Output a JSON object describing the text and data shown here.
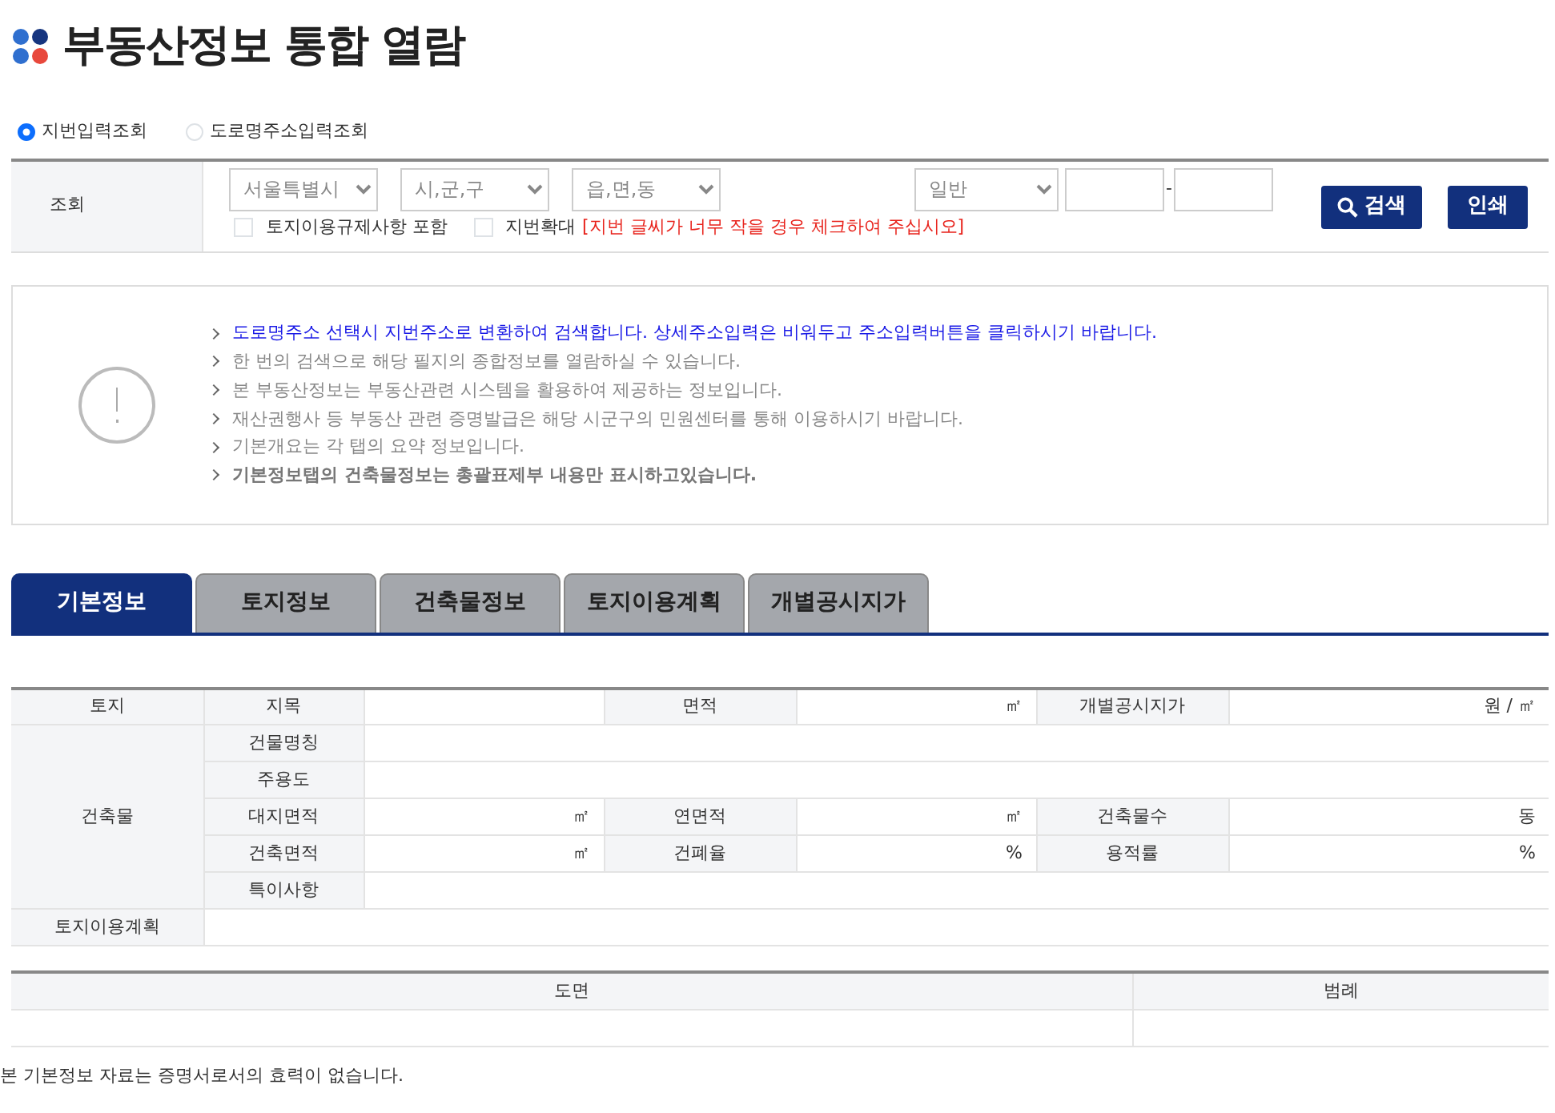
{
  "page": {
    "title": "부동산정보 통합 열람"
  },
  "search_mode": [
    {
      "label": "지번입력조회",
      "selected": true
    },
    {
      "label": "도로명주소입력조회",
      "selected": false
    }
  ],
  "search_form": {
    "label": "조회",
    "selects": [
      {
        "value": "서울특별시"
      },
      {
        "value": "시,군,구"
      },
      {
        "value": "읍,면,동"
      },
      {
        "value": "일반"
      }
    ],
    "separator": "-",
    "options": [
      {
        "label": "토지이용규제사항 포함",
        "checked": false
      },
      {
        "label": "지번확대",
        "checked": false,
        "note": "[지번 글씨가 너무 작을 경우 체크하여 주십시오]"
      }
    ],
    "buttons": [
      {
        "label": "검색",
        "kind": "search"
      },
      {
        "label": "인쇄",
        "kind": "plain"
      }
    ]
  },
  "notice": {
    "lines": [
      {
        "text": "도로명주소 선택시 지번주소로 변환하여 검색합니다. 상세주소입력은 비워두고 주소입력버튼을 클릭하시기 바랍니다.",
        "kind": "highlight"
      },
      {
        "text": "한 번의 검색으로 해당 필지의 종합정보를 열람하실 수 있습니다.",
        "kind": "normal"
      },
      {
        "text": "본 부동산정보는 부동산관련 시스템을 활용하여 제공하는 정보입니다.",
        "kind": "normal"
      },
      {
        "text": "재산권행사 등 부동산 관련 증명발급은 해당 시군구의 민원센터를 통해 이용하시기 바랍니다.",
        "kind": "normal"
      },
      {
        "text": "기본개요는 각 탭의 요약 정보입니다.",
        "kind": "normal"
      },
      {
        "text": "기본정보탭의 건축물정보는 총괄표제부 내용만 표시하고있습니다.",
        "kind": "bold"
      }
    ]
  },
  "tabs": [
    {
      "label": "기본정보",
      "selected": true
    },
    {
      "label": "토지정보",
      "selected": false
    },
    {
      "label": "건축물정보",
      "selected": false
    },
    {
      "label": "토지이용계획",
      "selected": false
    },
    {
      "label": "개별공시지가",
      "selected": false
    }
  ],
  "summary_table": {
    "groups": [
      {
        "label": "토지",
        "rows": [
          [
            {
              "label": "지목"
            },
            {
              "label": "면적",
              "unit": "㎡"
            },
            {
              "label": "개별공시지가",
              "unit": "원 / ㎡"
            }
          ]
        ]
      },
      {
        "label": "건축물",
        "rows": [
          [
            {
              "label": "건물명칭"
            }
          ],
          [
            {
              "label": "주용도"
            }
          ],
          [
            {
              "label": "대지면적",
              "unit": "㎡"
            },
            {
              "label": "연면적",
              "unit": "㎡"
            },
            {
              "label": "건축물수",
              "unit": "동"
            }
          ],
          [
            {
              "label": "건축면적",
              "unit": "㎡"
            },
            {
              "label": "건폐율",
              "unit": "%"
            },
            {
              "label": "용적률",
              "unit": "%"
            }
          ],
          [
            {
              "label": "특이사항"
            }
          ]
        ]
      },
      {
        "label": "토지이용계획",
        "rows": [
          []
        ]
      }
    ]
  },
  "drawing_table": {
    "columns": [
      "도면",
      "범례"
    ]
  },
  "footer_note": "본 기본정보 자료는 증명서로서의 효력이 없습니다."
}
